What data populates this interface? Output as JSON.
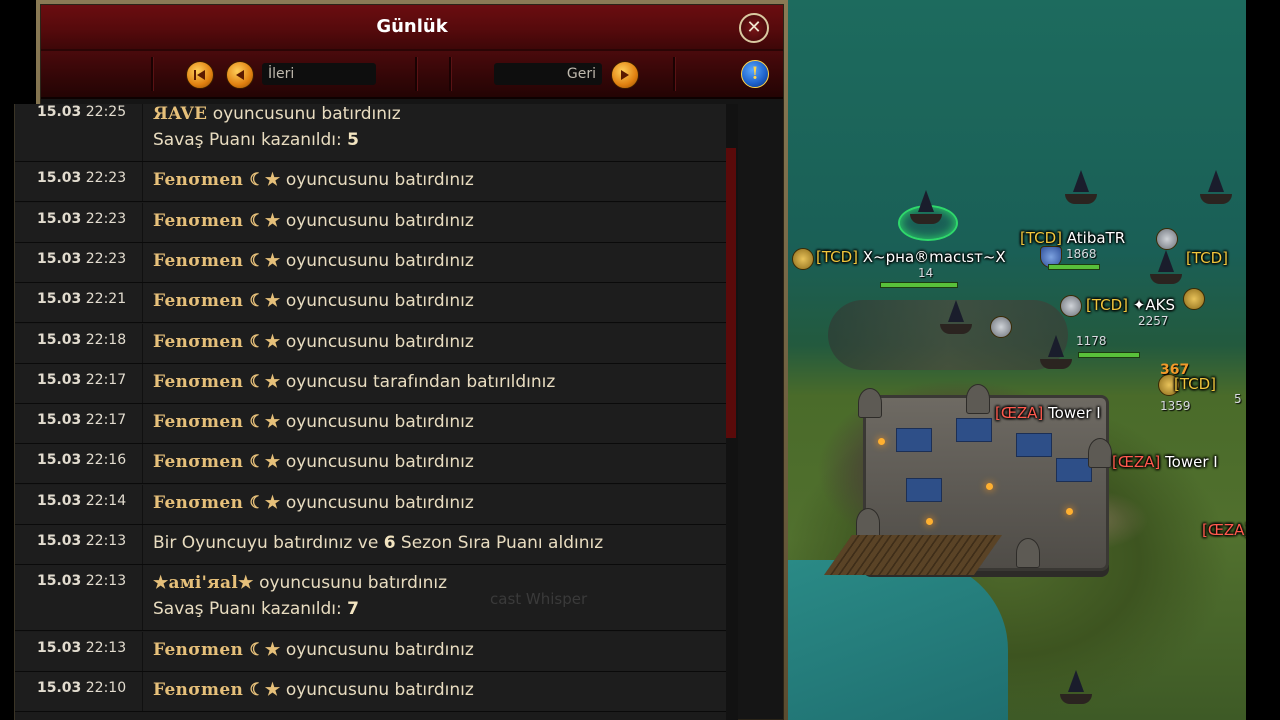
{
  "window": {
    "title": "Günlük",
    "close_glyph": "✕",
    "info_glyph": "!"
  },
  "toolbar": {
    "forward_label": "İleri",
    "back_label": "Geri"
  },
  "log": [
    {
      "date": "15.03",
      "time": "22:25",
      "player": "ЯAVE",
      "text": " oyuncusunu batırdınız",
      "line2_prefix": "Savaş Puanı kazanıldı: ",
      "line2_value": "5"
    },
    {
      "date": "15.03",
      "time": "22:23",
      "player": "Fenσmen ☾★",
      "text": " oyuncusunu batırdınız"
    },
    {
      "date": "15.03",
      "time": "22:23",
      "player": "Fenσmen ☾★",
      "text": " oyuncusunu batırdınız"
    },
    {
      "date": "15.03",
      "time": "22:23",
      "player": "Fenσmen ☾★",
      "text": " oyuncusunu batırdınız"
    },
    {
      "date": "15.03",
      "time": "22:21",
      "player": "Fenσmen ☾★",
      "text": " oyuncusunu batırdınız"
    },
    {
      "date": "15.03",
      "time": "22:18",
      "player": "Fenσmen ☾★",
      "text": " oyuncusunu batırdınız"
    },
    {
      "date": "15.03",
      "time": "22:17",
      "player": "Fenσmen ☾★",
      "text": " oyuncusu tarafından batırıldınız"
    },
    {
      "date": "15.03",
      "time": "22:17",
      "player": "Fenσmen ☾★",
      "text": " oyuncusunu batırdınız"
    },
    {
      "date": "15.03",
      "time": "22:16",
      "player": "Fenσmen ☾★",
      "text": " oyuncusunu batırdınız"
    },
    {
      "date": "15.03",
      "time": "22:14",
      "player": "Fenσmen ☾★",
      "text": " oyuncusunu batırdınız"
    },
    {
      "date": "15.03",
      "time": "22:13",
      "player": "",
      "text": "Bir Oyuncuyu batırdınız ve ",
      "value": "6",
      "suffix": " Sezon Sıra Puanı aldınız"
    },
    {
      "date": "15.03",
      "time": "22:13",
      "player": "★амi'яal★",
      "text": " oyuncusunu batırdınız",
      "line2_prefix": "Savaş Puanı kazanıldı: ",
      "line2_value": "7"
    },
    {
      "date": "15.03",
      "time": "22:13",
      "player": "Fenσmen ☾★",
      "text": " oyuncusunu batırdınız"
    },
    {
      "date": "15.03",
      "time": "22:10",
      "player": "Fenσmen ☾★",
      "text": " oyuncusunu batırdınız"
    }
  ],
  "chat_watermark": "cast Whisper",
  "map": {
    "labels": [
      {
        "tag": "[TCD]",
        "name": " X~pнa®macιsт~X",
        "tag_color": "yellow"
      },
      {
        "tag": "[TCD]",
        "name": " AtibaTR",
        "tag_color": "yellow"
      },
      {
        "tag": "[TCD]",
        "name": "",
        "tag_color": "yellow"
      },
      {
        "tag": "[TCD]",
        "name": " ✦AKS",
        "tag_color": "yellow"
      },
      {
        "tag": "[TCD]",
        "name": "",
        "tag_color": "yellow"
      },
      {
        "tag": "[ŒZA]",
        "name": " Tower I",
        "tag_color": "red"
      },
      {
        "tag": "[ŒZA]",
        "name": " Tower I",
        "tag_color": "red"
      },
      {
        "tag": "[ŒZA]",
        "name": "",
        "tag_color": "red"
      }
    ],
    "numbers": [
      "14",
      "1868",
      "2257",
      "1178",
      "367",
      "1359",
      "5"
    ]
  },
  "colors": {
    "title_bar": "#560a0c",
    "player_name": "#e6c07a",
    "map_tag_yellow": "#f0c53c",
    "map_tag_red": "#ff5a4e"
  }
}
